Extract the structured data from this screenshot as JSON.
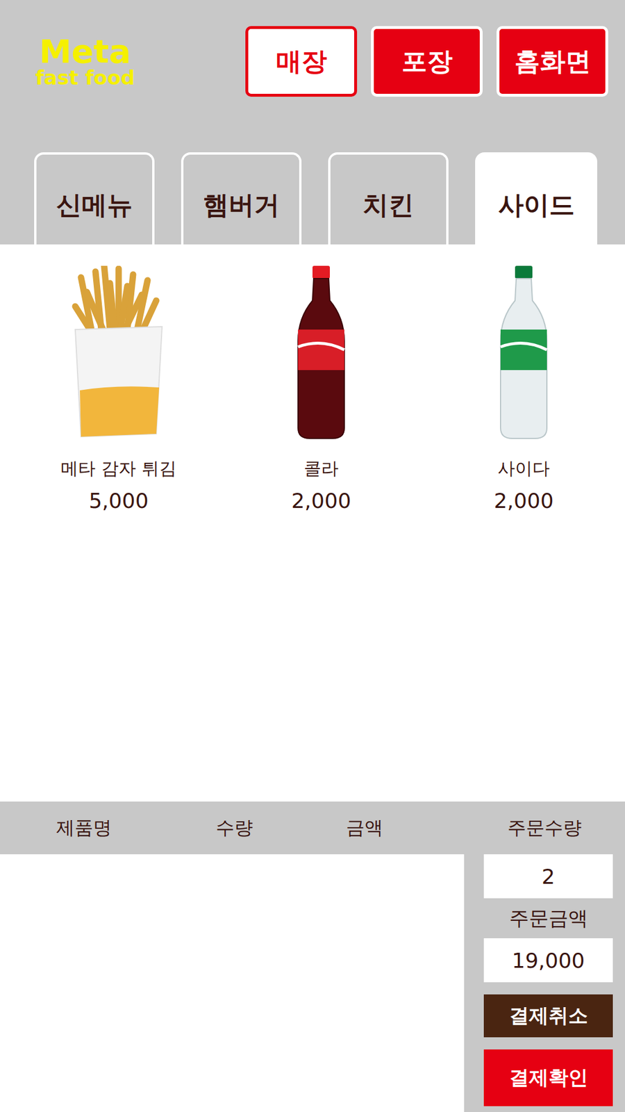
{
  "logo": {
    "title": "Meta",
    "subtitle": "fast food"
  },
  "header_buttons": [
    {
      "label": "매장",
      "selected": true
    },
    {
      "label": "포장",
      "selected": false
    },
    {
      "label": "홈화면",
      "selected": false
    }
  ],
  "tabs": [
    {
      "label": "신메뉴",
      "selected": false
    },
    {
      "label": "햄버거",
      "selected": false
    },
    {
      "label": "치킨",
      "selected": false
    },
    {
      "label": "사이드",
      "selected": true
    }
  ],
  "products": [
    {
      "name": "메타 감자 튀김",
      "price": "5,000",
      "kind": "fries"
    },
    {
      "name": "콜라",
      "price": "2,000",
      "kind": "cola"
    },
    {
      "name": "사이다",
      "price": "2,000",
      "kind": "cider"
    }
  ],
  "order_table": {
    "columns": [
      "제품명",
      "수량",
      "금액"
    ],
    "rows": []
  },
  "summary": {
    "quantity_label": "주문수량",
    "quantity": "2",
    "amount_label": "주문금액",
    "amount": "19,000"
  },
  "buttons": [
    {
      "label": "결제취소",
      "kind": "cancel"
    },
    {
      "label": "결제확인",
      "kind": "confirm"
    }
  ]
}
